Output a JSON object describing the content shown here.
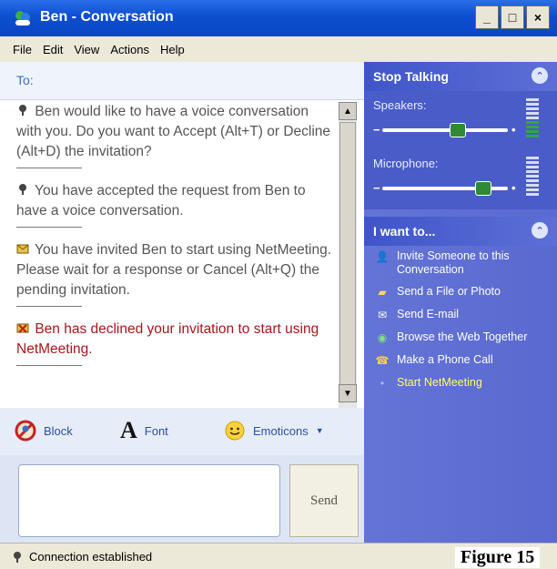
{
  "window": {
    "title": "Ben - Conversation"
  },
  "menu": [
    "File",
    "Edit",
    "View",
    "Actions",
    "Help"
  ],
  "to_label": "To:",
  "messages": [
    {
      "text": "Ben would like to have a voice conversation with you. Do you want to Accept (Alt+T) or Decline (Alt+D) the invitation?",
      "icon": "voice-icon",
      "color": "#555555"
    },
    {
      "text": "You have accepted the request from Ben to have a voice conversation.",
      "icon": "voice-icon",
      "color": "#555555"
    },
    {
      "text": "You have invited Ben to start using NetMeeting. Please wait for a response or Cancel (Alt+Q) the pending invitation.",
      "icon": "mail-icon",
      "color": "#555555"
    },
    {
      "text": "Ben has declined your invitation to start using NetMeeting.",
      "icon": "mail-error-icon",
      "color": "#a8161b"
    }
  ],
  "toolbar": {
    "block": "Block",
    "font": "Font",
    "emoticons": "Emoticons"
  },
  "send_label": "Send",
  "voice_panel": {
    "title": "Stop Talking",
    "speakers_label": "Speakers:",
    "microphone_label": "Microphone:",
    "speakers_level": 0.62,
    "microphone_level": 0.85
  },
  "tasks_panel": {
    "title": "I want to...",
    "links": [
      {
        "label": "Invite Someone to this Conversation",
        "icon": "invite-icon"
      },
      {
        "label": "Send a File or Photo",
        "icon": "folder-icon"
      },
      {
        "label": "Send E-mail",
        "icon": "email-icon"
      },
      {
        "label": "Browse the Web Together",
        "icon": "globe-icon"
      },
      {
        "label": "Make a Phone Call",
        "icon": "phone-icon"
      },
      {
        "label": "Start NetMeeting",
        "icon": "bullet-icon",
        "highlight": true
      }
    ]
  },
  "status": {
    "text": "Connection established"
  },
  "caption": "Figure 15",
  "colors": {
    "title_bar": "#0c4fd0",
    "side_panel": "#5a69cf",
    "error_text": "#a8161b",
    "link_highlight": "#ffff66"
  }
}
